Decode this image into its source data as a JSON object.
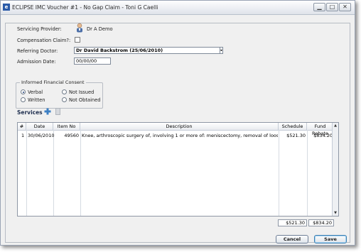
{
  "window": {
    "title": "ECLIPSE IMC Voucher #1 - No Gap Claim - Toni G Caelli",
    "app_icon": "e",
    "minimize": "▁",
    "maximize": "□",
    "close": "✕"
  },
  "form": {
    "servicing_provider_label": "Servicing Provider:",
    "servicing_provider_value": "Dr A Demo",
    "compensation_label": "Compensation Claim?:",
    "referring_doctor_label": "Referring Doctor:",
    "referring_doctor_value": "Dr David Backstrom (25/06/2010)",
    "admission_date_label": "Admission Date:",
    "admission_date_value": "00/00/00"
  },
  "consent": {
    "title": "Informed Financial Consent",
    "options": {
      "verbal": "Verbal",
      "written": "Written",
      "not_issued": "Not Issued",
      "not_obtained": "Not Obtained"
    },
    "selected": "Verbal"
  },
  "services": {
    "title": "Services",
    "columns": [
      "#",
      "Date",
      "Item No",
      "Description",
      "Schedule",
      "Fund Rebate"
    ],
    "rows": [
      {
        "num": "1",
        "date": "30/06/2010",
        "item_no": "49560",
        "description": "Knee, arthroscopic surgery of, involving 1 or more of: meniscectomy, removal of loose body",
        "schedule": "$521.30",
        "fund_rebate": "$834.20"
      }
    ],
    "total_schedule": "$521.30",
    "total_fund_rebate": "$834.20"
  },
  "buttons": {
    "cancel": "Cancel",
    "save": "Save"
  }
}
